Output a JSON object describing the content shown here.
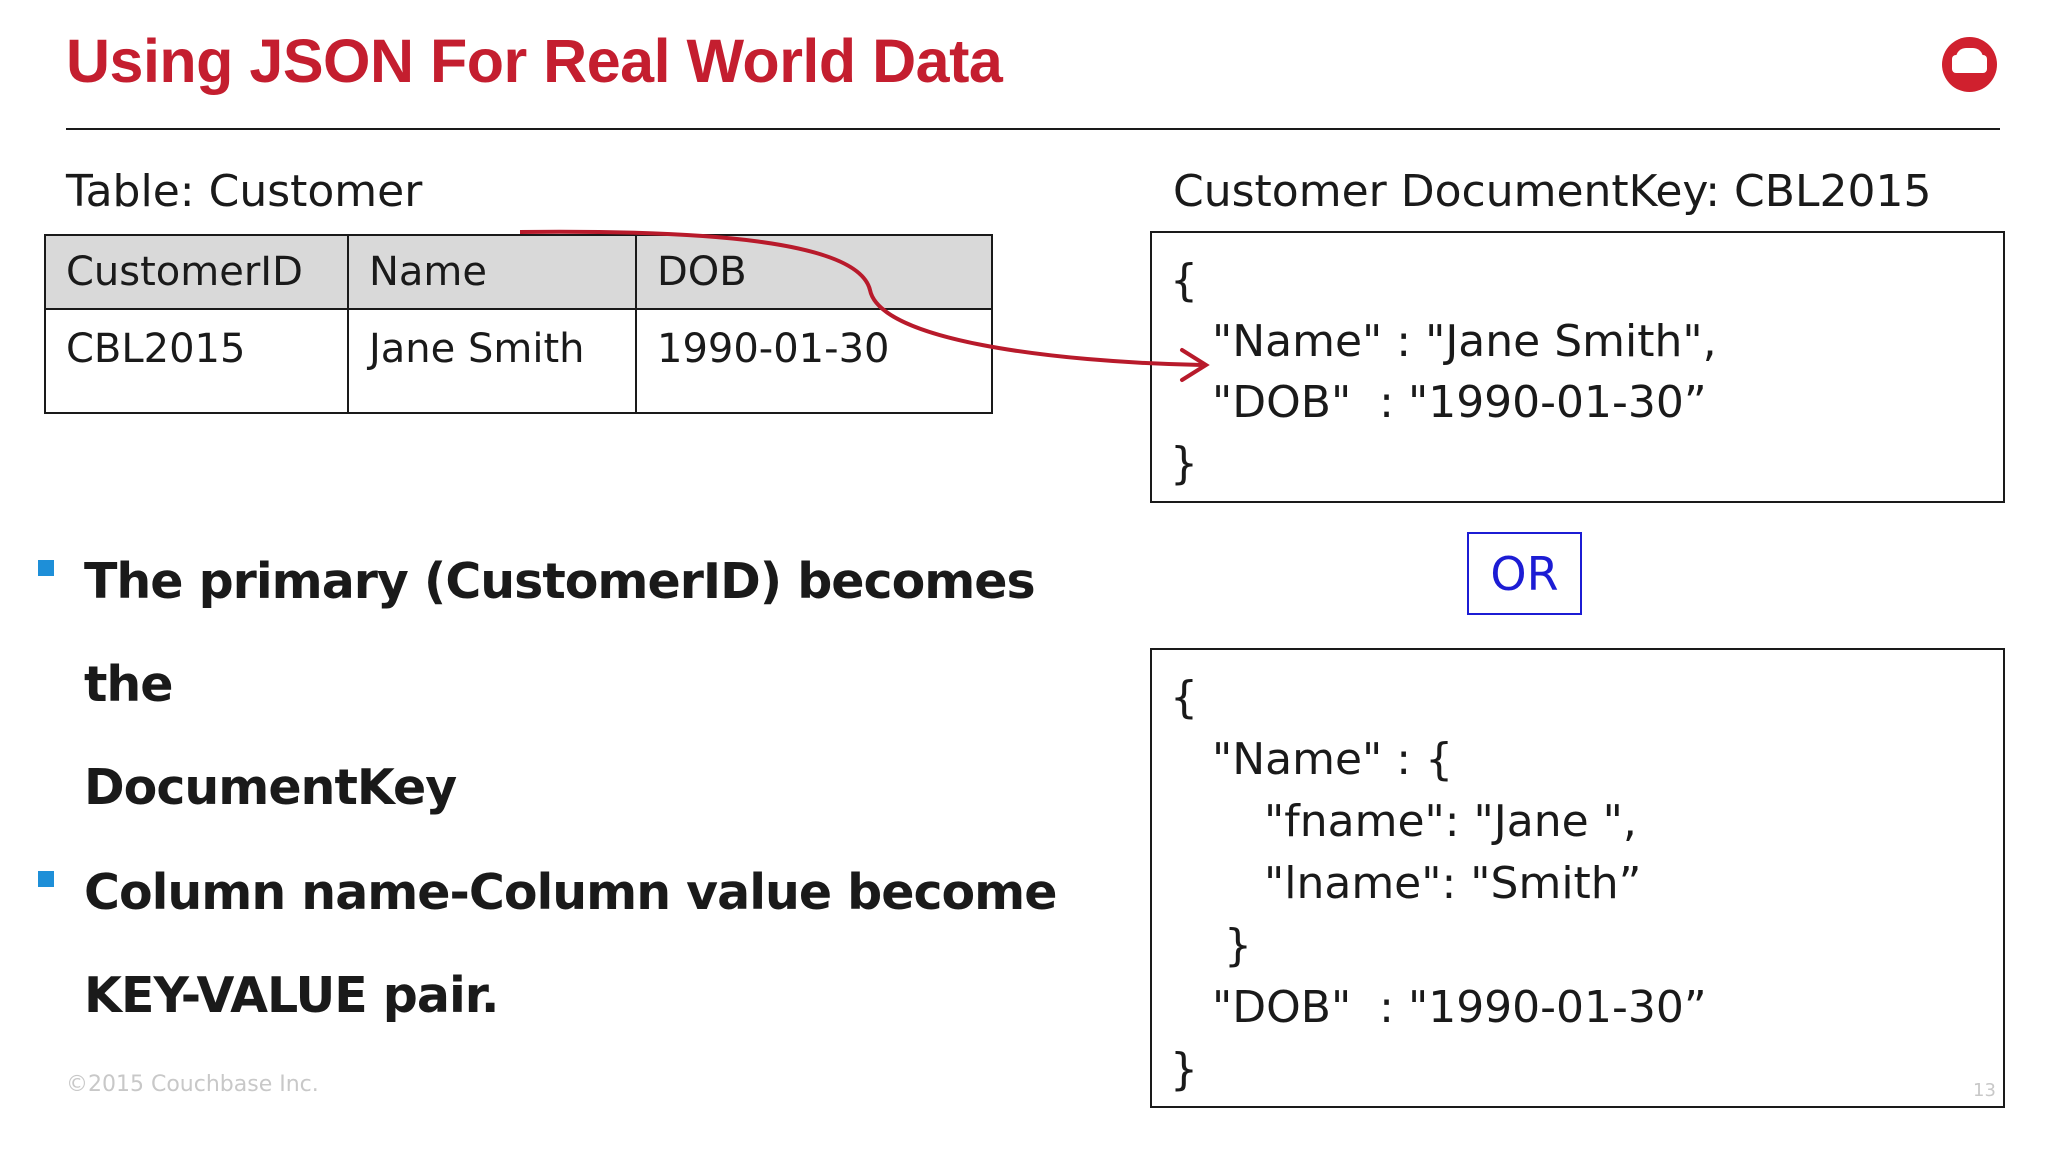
{
  "slide": {
    "title": "Using JSON For Real World Data",
    "logo_icon": "couchbase-logo-icon"
  },
  "table": {
    "caption": "Table: Customer",
    "headers": [
      "CustomerID",
      "Name",
      "DOB"
    ],
    "rows": [
      [
        "CBL2015",
        "Jane Smith",
        "1990-01-30"
      ]
    ]
  },
  "document": {
    "caption": "Customer DocumentKey: CBL2015",
    "flat_lines": [
      "{",
      "\"Name\" : \"Jane Smith\",",
      "\"DOB\"  : \"1990-01-30”",
      "}"
    ],
    "or_label": "OR",
    "nested_lines": [
      "{",
      "\"Name\" : {",
      "\"fname\": \"Jane \",",
      "\"lname\": \"Smith”",
      "}",
      "\"DOB\"  : \"1990-01-30”",
      "}"
    ]
  },
  "bullets": [
    {
      "line1": "The primary (CustomerID) becomes the",
      "line2": "DocumentKey"
    },
    {
      "line1": "Column name-Column value become",
      "line2": "KEY-VALUE pair."
    }
  ],
  "footer": {
    "copyright": "©2015 Couchbase Inc.",
    "page_number": "13"
  },
  "colors": {
    "title": "#c41e2f",
    "arrow": "#b81a2b",
    "bullet": "#1e8fd8",
    "or_border": "#1c1cd4"
  }
}
